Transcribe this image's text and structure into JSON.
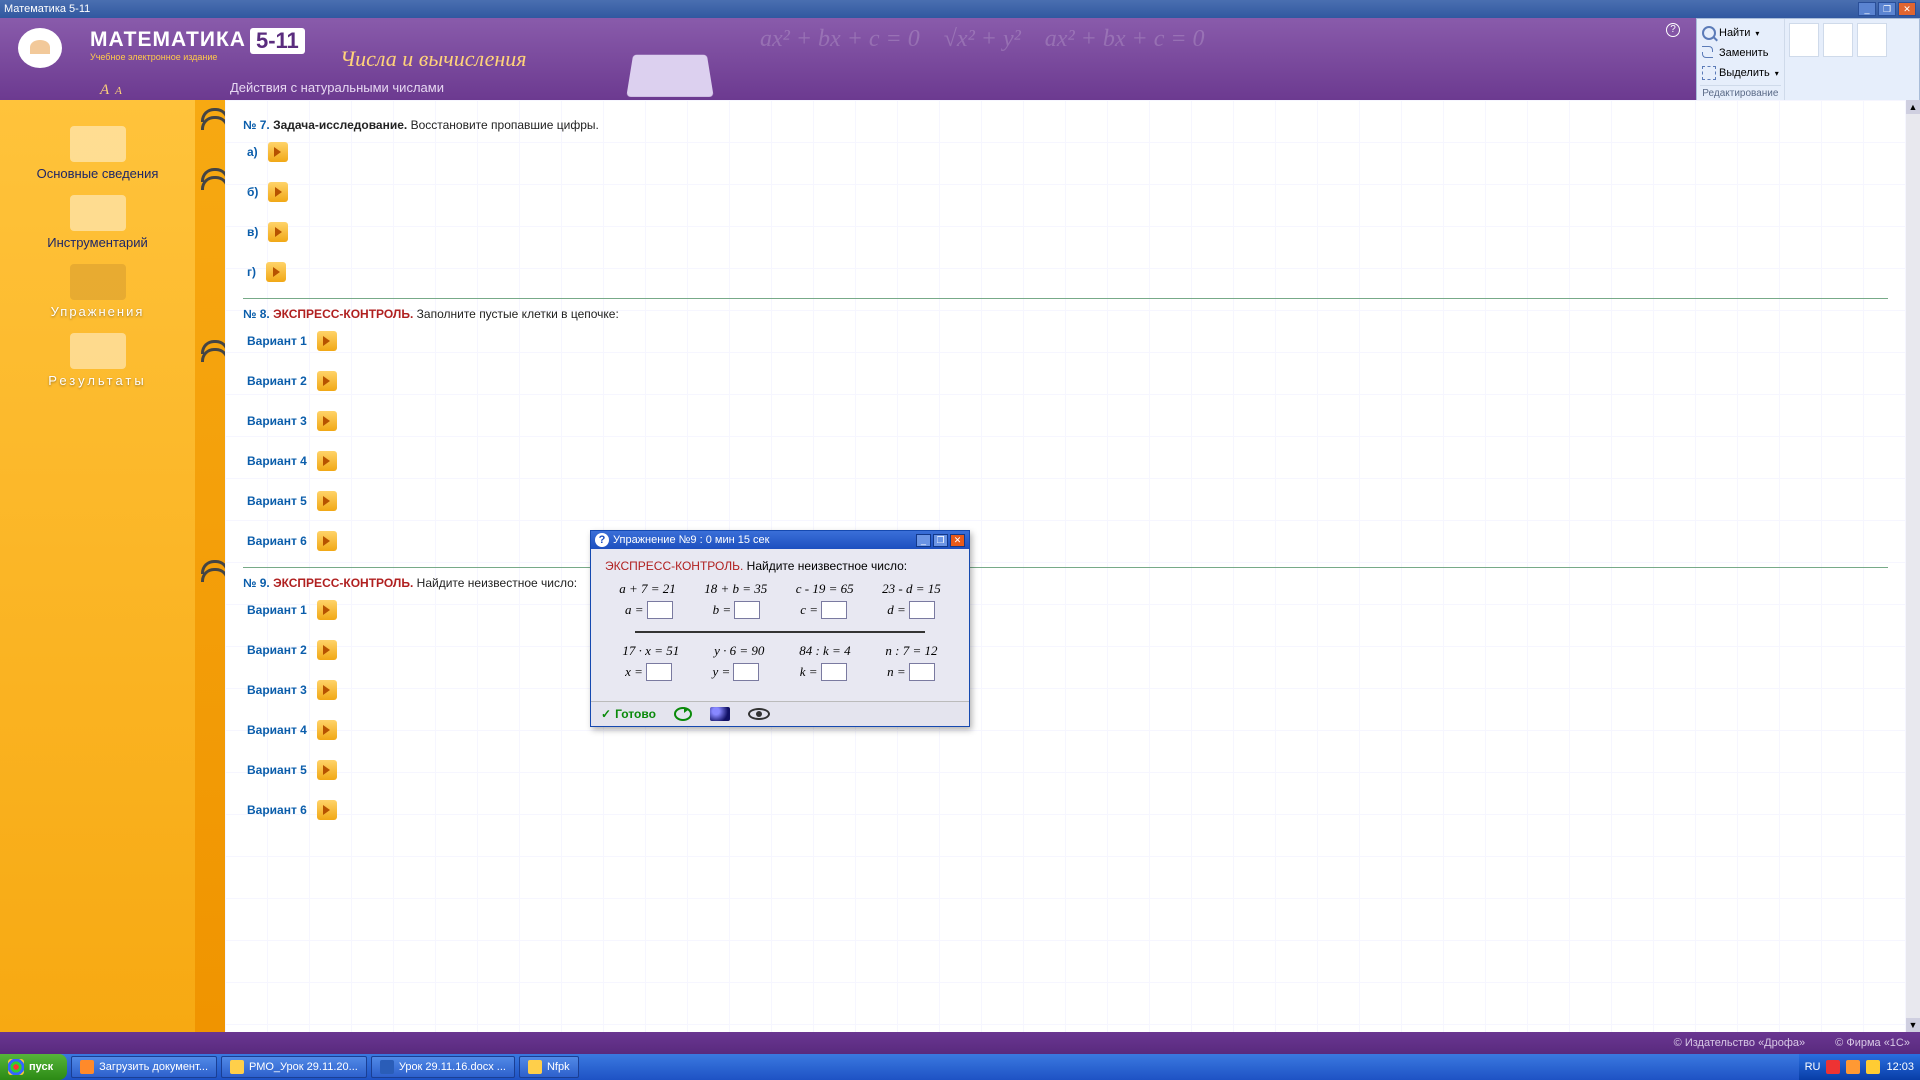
{
  "window": {
    "title": "Математика 5-11"
  },
  "brand": {
    "name": "МАТЕМАТИКА",
    "nums": "5-11",
    "sub": "Учебное электронное издание"
  },
  "header": {
    "title": "Числа и вычисления",
    "sub": "Действия с натуральными числами"
  },
  "ribbon": {
    "find": "Найти",
    "replace": "Заменить",
    "select": "Выделить",
    "group": "Редактирование"
  },
  "sidebar": {
    "items": [
      {
        "label": "Основные сведения"
      },
      {
        "label": "Инструментарий"
      },
      {
        "label": "Упражнения"
      },
      {
        "label": "Результаты"
      }
    ]
  },
  "tasks": {
    "t7": {
      "num": "№ 7.",
      "type": "Задача-исследование.",
      "instr": "Восстановите пропавшие цифры.",
      "items": [
        "а)",
        "б)",
        "в)",
        "г)"
      ]
    },
    "t8": {
      "num": "№ 8.",
      "type": "ЭКСПРЕСС-КОНТРОЛЬ.",
      "instr": "Заполните пустые клетки в цепочке:",
      "items": [
        "Вариант 1",
        "Вариант 2",
        "Вариант 3",
        "Вариант 4",
        "Вариант 5",
        "Вариант 6"
      ]
    },
    "t9": {
      "num": "№ 9.",
      "type": "ЭКСПРЕСС-КОНТРОЛЬ.",
      "instr": "Найдите неизвестное число:",
      "items": [
        "Вариант 1",
        "Вариант 2",
        "Вариант 3",
        "Вариант 4",
        "Вариант 5",
        "Вариант 6"
      ]
    }
  },
  "popup": {
    "title": "Упражнение №9 : 0 мин  15 сек",
    "type": "ЭКСПРЕСС-КОНТРОЛЬ.",
    "instr": "Найдите неизвестное число:",
    "row1": {
      "eq": [
        "a + 7 = 21",
        "18 + b = 35",
        "c - 19 = 65",
        "23 - d = 15"
      ],
      "vars": [
        "a =",
        "b =",
        "c =",
        "d ="
      ]
    },
    "row2": {
      "eq": [
        "17 · x = 51",
        "y · 6 = 90",
        "84 : k = 4",
        "n : 7 = 12"
      ],
      "vars": [
        "x =",
        "y =",
        "k =",
        "n ="
      ]
    },
    "done": "Готово"
  },
  "footer": {
    "left": "© Издательство «Дрофа»",
    "right": "© Фирма «1С»"
  },
  "taskbar": {
    "start": "пуск",
    "buttons": [
      "Загрузить документ...",
      "РМО_Урок 29.11.20...",
      "Урок 29.11.16.docx ...",
      "Nfpk"
    ],
    "lang": "RU",
    "clock": "12:03"
  }
}
